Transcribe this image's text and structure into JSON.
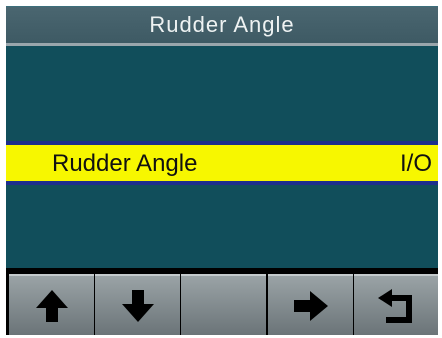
{
  "header": {
    "title": "Rudder Angle"
  },
  "menu": {
    "items": [
      {
        "label": "Rudder Angle",
        "value": "I/O",
        "selected": true
      }
    ],
    "highlight_color": "#f7f700",
    "background_color": "#104d5a"
  },
  "softkeys": [
    {
      "icon": "arrow-up-icon"
    },
    {
      "icon": "arrow-down-icon"
    },
    {
      "icon": ""
    },
    {
      "icon": "arrow-right-icon"
    },
    {
      "icon": "back-return-icon"
    }
  ]
}
